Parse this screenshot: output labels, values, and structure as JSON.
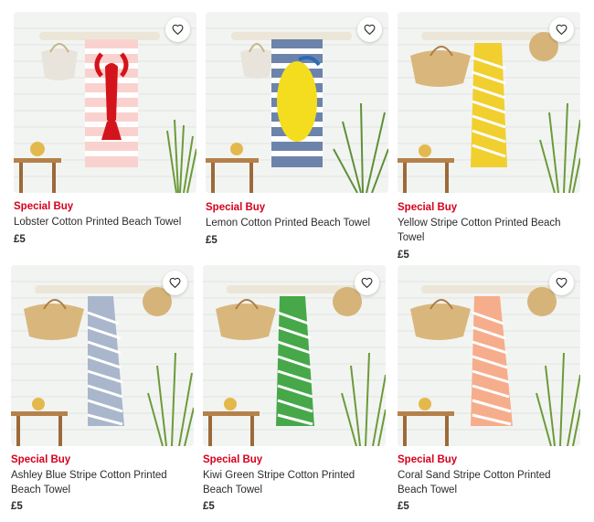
{
  "colors": {
    "special_buy": "#d6001c",
    "text": "#2b2b2b",
    "panel": "#f1f3f1"
  },
  "products": [
    {
      "badge": "Special Buy",
      "name": "Lobster Cotton Printed Beach Towel",
      "price": "£5",
      "towel": "lobster",
      "icon": "heart-outline-icon"
    },
    {
      "badge": "Special Buy",
      "name": "Lemon Cotton Printed Beach Towel",
      "price": "£5",
      "towel": "lemon",
      "icon": "heart-outline-icon"
    },
    {
      "badge": "Special Buy",
      "name": "Yellow Stripe Cotton Printed Beach Towel",
      "price": "£5",
      "towel": "yellow-stripe",
      "icon": "heart-outline-icon"
    },
    {
      "badge": "Special Buy",
      "name": "Ashley Blue Stripe Cotton Printed Beach Towel",
      "price": "£5",
      "towel": "blue-stripe",
      "icon": "heart-outline-icon"
    },
    {
      "badge": "Special Buy",
      "name": "Kiwi Green Stripe Cotton Printed Beach Towel",
      "price": "£5",
      "towel": "green-stripe",
      "icon": "heart-outline-icon"
    },
    {
      "badge": "Special Buy",
      "name": "Coral Sand Stripe Cotton Printed Beach Towel",
      "price": "£5",
      "towel": "coral-stripe",
      "icon": "heart-outline-icon"
    }
  ]
}
